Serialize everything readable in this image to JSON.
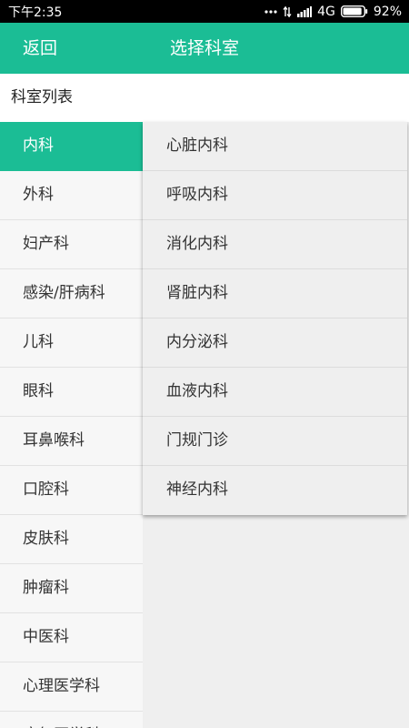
{
  "status_bar": {
    "time": "下午2:35",
    "network": "4G",
    "battery": "92%",
    "battery_level": 0.92
  },
  "header": {
    "back_label": "返回",
    "title": "选择科室"
  },
  "section": {
    "heading": "科室列表"
  },
  "left_list": {
    "selected_index": 0,
    "items": [
      "内科",
      "外科",
      "妇产科",
      "感染/肝病科",
      "儿科",
      "眼科",
      "耳鼻喉科",
      "口腔科",
      "皮肤科",
      "肿瘤科",
      "中医科",
      "心理医学科",
      "康复医学科"
    ]
  },
  "right_list": {
    "items": [
      "心脏内科",
      "呼吸内科",
      "消化内科",
      "肾脏内科",
      "内分泌科",
      "血液内科",
      "门规门诊",
      "神经内科"
    ]
  },
  "colors": {
    "accent": "#1bbd95",
    "status_bar": "#000000",
    "background": "#efefef"
  },
  "icons": [
    "notification-dots-icon",
    "data-transfer-icon",
    "signal-icon",
    "battery-icon"
  ]
}
